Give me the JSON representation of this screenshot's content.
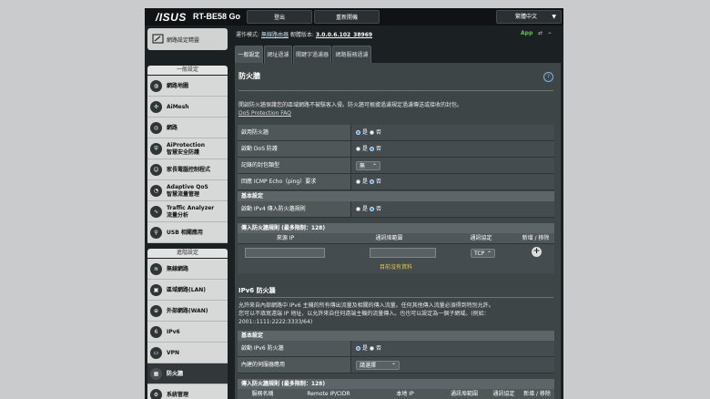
{
  "header": {
    "logo": "/ISUS",
    "model": "RT-BE58 Go",
    "logout": "登出",
    "reboot": "重新開機",
    "language": "繁體中文"
  },
  "sidebar": {
    "quick": "網路設定精靈",
    "general_title": "一般設定",
    "general": [
      {
        "label": "網路地圖",
        "icon": "globe-icon"
      },
      {
        "label": "AiMesh",
        "icon": "mesh-icon"
      },
      {
        "label": "網路",
        "icon": "globe-icon"
      },
      {
        "label": "AiProtection",
        "sub": "智慧安全防護",
        "icon": "shield-icon"
      },
      {
        "label": "家長電腦控制程式",
        "icon": "family-icon"
      },
      {
        "label": "Adaptive QoS",
        "sub": "智慧流量管理",
        "icon": "qos-icon"
      },
      {
        "label": "Traffic Analyzer",
        "sub": "流量分析",
        "icon": "analyzer-icon"
      },
      {
        "label": "USB 相關應用",
        "icon": "usb-icon"
      }
    ],
    "advanced_title": "進階設定",
    "advanced": [
      {
        "label": "無線網路",
        "icon": "wifi-icon"
      },
      {
        "label": "區域網路(LAN)",
        "icon": "lan-icon"
      },
      {
        "label": "外部網路(WAN)",
        "icon": "wan-icon"
      },
      {
        "label": "IPv6",
        "icon": "ipv6-icon"
      },
      {
        "label": "VPN",
        "icon": "vpn-icon"
      },
      {
        "label": "防火牆",
        "icon": "firewall-icon",
        "active": true
      },
      {
        "label": "系統管理",
        "icon": "admin-icon"
      }
    ]
  },
  "status": {
    "mode_label": "運作模式:",
    "mode_value": "無線路由器",
    "fw_label": "韌體版本:",
    "fw_value": "3.0.0.6.102_38969",
    "app": "App"
  },
  "tabs": [
    "一般設定",
    "網址過濾",
    "關鍵字過濾器",
    "網路服務過濾"
  ],
  "panel": {
    "title": "防火牆",
    "help": "?",
    "desc": "開啟防火牆保護您的區域網路不被駭客入侵。防火牆可根據過濾規定過濾傳送或接收的封包。",
    "dos_link": "DoS Protection FAQ",
    "rows": [
      {
        "label": "啟用防火牆",
        "yes": "是",
        "no": "否",
        "selected": "yes"
      },
      {
        "label": "啟動 DoS 防護",
        "yes": "是",
        "no": "否",
        "selected": "no"
      },
      {
        "label": "記錄的封包類型",
        "select": "無"
      },
      {
        "label": "回應 ICMP Echo（ping）要求",
        "yes": "是",
        "no": "否",
        "selected": "no"
      }
    ],
    "basic_title": "基本設定",
    "ipv4_row": {
      "label": "啟動 IPv4 傳入防火牆規則",
      "yes": "是",
      "no": "否",
      "selected": "no"
    },
    "rules_title": "傳入防火牆規則 (最多限制：128)",
    "rules_head": [
      "來源 IP",
      "通訊埠範圍",
      "通訊協定",
      "新增 / 移除"
    ],
    "protocol": "TCP",
    "nodata": "目前沒有資料",
    "ipv6_title": "IPv6 防火牆",
    "ipv6_desc1": "允許來自內部網路中 IPv6 主機的所有傳出流量及相關的傳入流量。任何其他傳入流量必須得到特別允許。",
    "ipv6_desc2": "您可以不填寫遠端 IP 地址，以允許來自任何遠端主機的流量傳入。也也可以設定為一個子網域。(例如：",
    "ipv6_desc3": "2001::1111:2222:3333/64)",
    "ipv6_basic": "基本設定",
    "ipv6_row1": {
      "label": "啟動 IPv6 防火牆",
      "yes": "是",
      "no": "否",
      "selected": "yes"
    },
    "ipv6_row2": {
      "label": "內建的伺服器應用",
      "select": "請選擇"
    },
    "ipv6_rules_title": "傳入防火牆規則 (最多限制：128)",
    "ipv6_head": [
      "服務名稱",
      "Remote IP/CIDR",
      "本地 IP",
      "通訊埠範圍",
      "通訊協定",
      "新增 / 移除"
    ]
  }
}
